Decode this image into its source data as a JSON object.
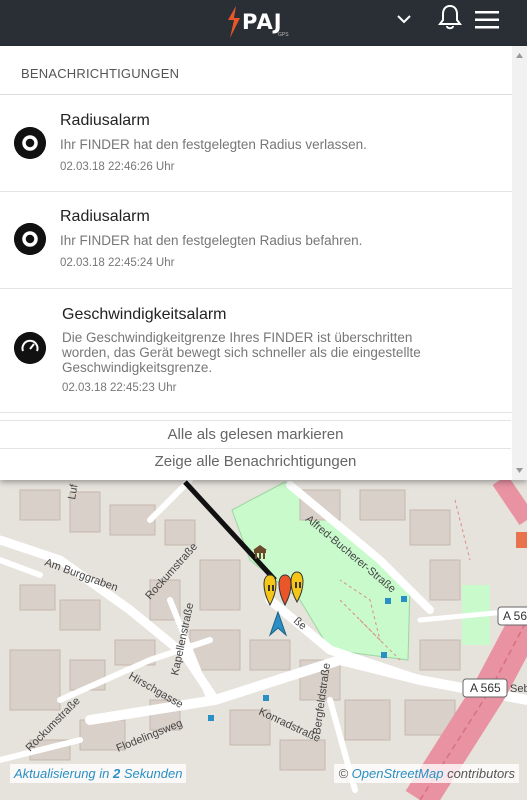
{
  "header": {
    "logo_text": "PAJ",
    "logo_sub": "GPS",
    "brand_color": "#e8562a",
    "icons": [
      "chevron-down-icon",
      "bell-icon",
      "hamburger-menu-icon"
    ]
  },
  "notifications": {
    "title": "BENACHRICHTIGUNGEN",
    "items": [
      {
        "title": "Radiusalarm",
        "text": "Ihr FINDER hat den festgelegten Radius verlassen.",
        "time": "02.03.18 22:46:26 Uhr",
        "icon": "radius-alarm-icon"
      },
      {
        "title": "Radiusalarm",
        "text": "Ihr FINDER hat den festgelegten Radius befahren.",
        "time": "02.03.18 22:45:24 Uhr",
        "icon": "radius-alarm-icon"
      },
      {
        "title": "Geschwindigkeitsalarm",
        "text_lines": [
          "Die Geschwindigkeitgrenze Ihres FINDER ist überschritten",
          "worden, das Gerät bewegt sich schneller als die eingestellte",
          "Geschwindigkeitsgrenze."
        ],
        "time": "02.03.18 22:45:23 Uhr",
        "icon": "speedometer-icon"
      }
    ],
    "mark_all_read": "Alle als gelesen markieren",
    "show_all": "Zeige alle Benachrichtigungen"
  },
  "map": {
    "streets": [
      "Am Burggraben",
      "Rockumstraße",
      "Kapellenstraße",
      "Hirschgasse",
      "Rockumstraße",
      "Flodelingsweg",
      "Konradstraße",
      "Bergfeldstraße",
      "Alfred-Bucherer-Straße",
      "A 565",
      "A 56",
      "Seb",
      "Luf",
      "ße"
    ],
    "colors": {
      "motorway": "#e892a2",
      "park": "#c8facc",
      "building": "#d9d0c9",
      "marker": "#f5c518",
      "route": "#111111",
      "arrow": "#2a8fc5"
    }
  },
  "footer": {
    "update_prefix": "Aktualisierung in",
    "update_seconds": "2",
    "update_suffix": "Sekunden",
    "attribution_prefix": "©",
    "attribution_link": "OpenStreetMap",
    "attribution_suffix": "contributors"
  }
}
